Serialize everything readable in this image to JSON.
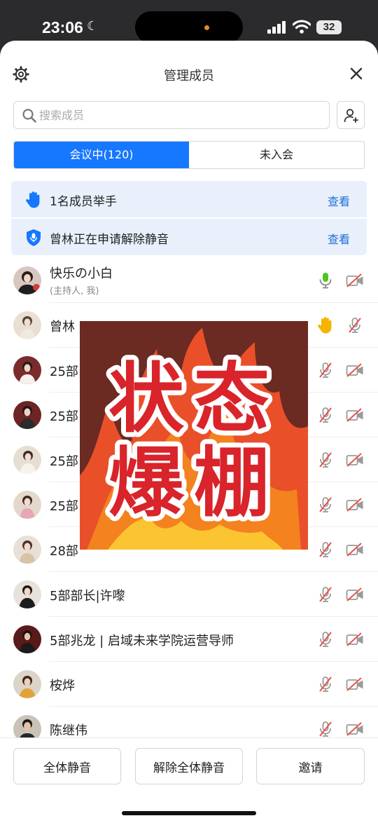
{
  "status_bar": {
    "time": "23:06",
    "battery": "32",
    "moon_glyph": "☾"
  },
  "header": {
    "title": "管理成员"
  },
  "search": {
    "placeholder": "搜索成员",
    "value": ""
  },
  "tabs": [
    {
      "label": "会议中(120)",
      "active": true
    },
    {
      "label": "未入会",
      "active": false
    }
  ],
  "notices": [
    {
      "text": "1名成员举手",
      "link": "查看",
      "icon": "hand-icon"
    },
    {
      "text": "曾林正在申请解除静音",
      "link": "查看",
      "icon": "shield-icon"
    }
  ],
  "members": [
    {
      "name": "快乐の小白",
      "subtitle": "(主持人, 我)",
      "mic": "mic-on-icon",
      "video": "video-off-icon"
    },
    {
      "name": "曾林",
      "mic": "raise-hand-icon",
      "video": "mic-muted-icon"
    },
    {
      "name": "25部",
      "mic": "mic-muted-icon",
      "video": "video-off-icon"
    },
    {
      "name": "25部",
      "mic": "mic-muted-icon",
      "video": "video-off-icon"
    },
    {
      "name": "25部",
      "mic": "mic-muted-icon",
      "video": "video-off-icon"
    },
    {
      "name": "25部",
      "mic": "mic-muted-icon",
      "video": "video-off-icon"
    },
    {
      "name": "28部",
      "mic": "mic-muted-icon",
      "video": "video-off-icon"
    },
    {
      "name": "5部部长|许嚟",
      "mic": "mic-muted-icon",
      "video": "video-off-icon"
    },
    {
      "name": "5部兆龙 | 启域未来学院运营导师",
      "mic": "mic-muted-icon",
      "video": "video-off-icon"
    },
    {
      "name": "桉烨",
      "mic": "mic-muted-icon",
      "video": "video-off-icon"
    },
    {
      "name": "陈继伟",
      "mic": "mic-muted-icon",
      "video": "video-off-icon"
    }
  ],
  "sticker": {
    "line1": "状态",
    "line2": "爆棚"
  },
  "bottom_buttons": {
    "mute_all": "全体静音",
    "unmute_all": "解除全体静音",
    "invite": "邀请"
  },
  "colors": {
    "accent": "#1677ff",
    "link": "#1f6fd6",
    "notice_bg": "#e9f0fb",
    "mic_on": "#52c41a",
    "muted_red": "#e8504a",
    "hand": "#f5b400"
  }
}
